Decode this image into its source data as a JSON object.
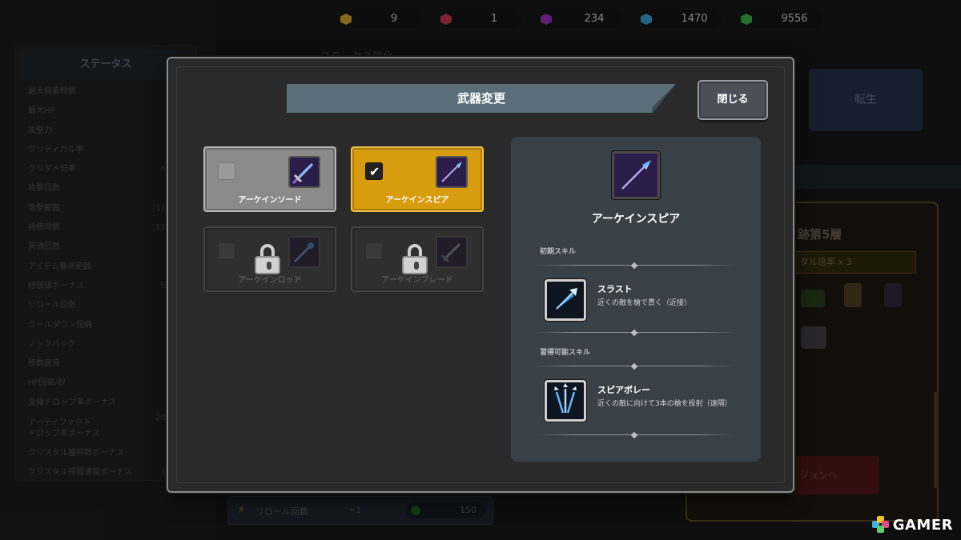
{
  "currencies": [
    {
      "name": "yellow-gem",
      "color": "#f2c22e",
      "amount": "9"
    },
    {
      "name": "red-gem",
      "color": "#e0405a",
      "amount": "1"
    },
    {
      "name": "purple-gem",
      "color": "#b03ad8",
      "amount": "234"
    },
    {
      "name": "blue-gem",
      "color": "#46b4f0",
      "amount": "1470"
    },
    {
      "name": "green-gem",
      "color": "#3fcf52",
      "amount": "9556"
    }
  ],
  "background": {
    "status_panel": {
      "title": "ステータス",
      "rows": [
        {
          "label": "最大探索時間",
          "value": ""
        },
        {
          "label": "最大HP",
          "value": ""
        },
        {
          "label": "攻撃力",
          "value": ""
        },
        {
          "label": "クリティカル率",
          "value": ""
        },
        {
          "label": "クリダメ倍率",
          "value": "6"
        },
        {
          "label": "攻撃回数",
          "value": ""
        },
        {
          "label": "攻撃範囲",
          "value": "11"
        },
        {
          "label": "持続時間",
          "value": "11"
        },
        {
          "label": "貫通回数",
          "value": ""
        },
        {
          "label": "アイテム獲得範囲",
          "value": ""
        },
        {
          "label": "経験値ボーナス",
          "value": "5"
        },
        {
          "label": "リロール回数",
          "value": ""
        },
        {
          "label": "クールダウン短縮",
          "value": ""
        },
        {
          "label": "ノックバック",
          "value": ""
        },
        {
          "label": "移動速度",
          "value": ""
        },
        {
          "label": "HP回復/秒",
          "value": ""
        },
        {
          "label": "宝箱ドロップ率ボーナス",
          "value": ""
        },
        {
          "label": "アーティファクト\nドロップ率ボーナス",
          "value": "20"
        },
        {
          "label": "クリスタル獲得数ボーナス",
          "value": ""
        },
        {
          "label": "クリスタル採掘速度ボーナス",
          "value": "1"
        }
      ]
    },
    "mid_title": "ステータス強化",
    "rebirth_button": "転生",
    "floor_title": "跡第5層",
    "floor_badge": "タル倍率 x 3",
    "dungeon_button": "ジョンへ",
    "reroll_bar": {
      "label": "リロール回数",
      "plus": "+1",
      "cost": "150"
    }
  },
  "modal": {
    "title": "武器変更",
    "close_label": "閉じる",
    "weapons": [
      {
        "id": "sword",
        "name": "アーケインソード",
        "state": "unlocked",
        "checked": false
      },
      {
        "id": "spear",
        "name": "アーケインスピア",
        "state": "selected",
        "checked": true
      },
      {
        "id": "rod",
        "name": "アーケインロッド",
        "state": "locked",
        "checked": false
      },
      {
        "id": "blade",
        "name": "アーケインブレード",
        "state": "locked",
        "checked": false
      }
    ],
    "detail": {
      "weapon_name": "アーケインスピア",
      "initial_skill_header": "初期スキル",
      "initial_skill": {
        "name": "スラスト",
        "description": "近くの敵を槍で貫く（近接）"
      },
      "learnable_skill_header": "習得可能スキル",
      "learnable_skill": {
        "name": "スピアボレー",
        "description": "近くの敵に向けて3本の槍を投射（遠隔）"
      }
    }
  },
  "watermark": "GAMER"
}
